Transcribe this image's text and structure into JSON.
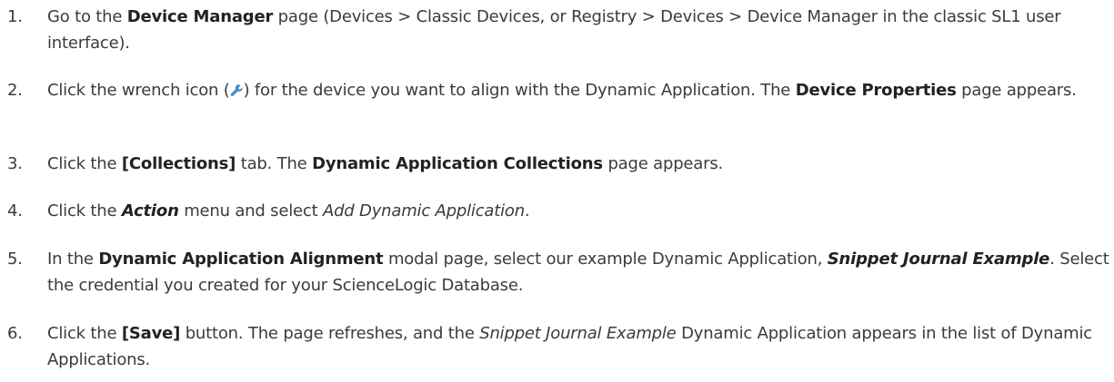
{
  "steps": [
    {
      "number": "1.",
      "parts": [
        "Go to the ",
        "Device Manager",
        " page (Devices > Classic Devices, or Registry > Devices > Device Manager in the classic SL1 user interface)."
      ]
    },
    {
      "number": "2.",
      "parts": [
        "Click the wrench icon (",
        ") for the device you want to align with the Dynamic Application. The ",
        "Device Properties",
        " page appears."
      ],
      "icon": "wrench-icon"
    },
    {
      "number": "3.",
      "parts": [
        "Click the ",
        "[Collections]",
        " tab. The ",
        "Dynamic Application Collections",
        " page appears."
      ]
    },
    {
      "number": "4.",
      "parts": [
        "Click the ",
        "Action",
        " menu and select ",
        "Add Dynamic Application",
        "."
      ]
    },
    {
      "number": "5.",
      "parts": [
        "In the ",
        "Dynamic Application Alignment",
        " modal page, select our example Dynamic Application, ",
        "Snippet Journal Example",
        ". Select the credential you created for your ScienceLogic Database."
      ]
    },
    {
      "number": "6.",
      "parts": [
        "Click the ",
        "[Save]",
        " button. The page refreshes, and the ",
        "Snippet Journal Example",
        "  Dynamic Application appears in the list of Dynamic Applications."
      ]
    }
  ],
  "colors": {
    "text": "#3b3b3b",
    "wrench": "#4a90d9"
  }
}
